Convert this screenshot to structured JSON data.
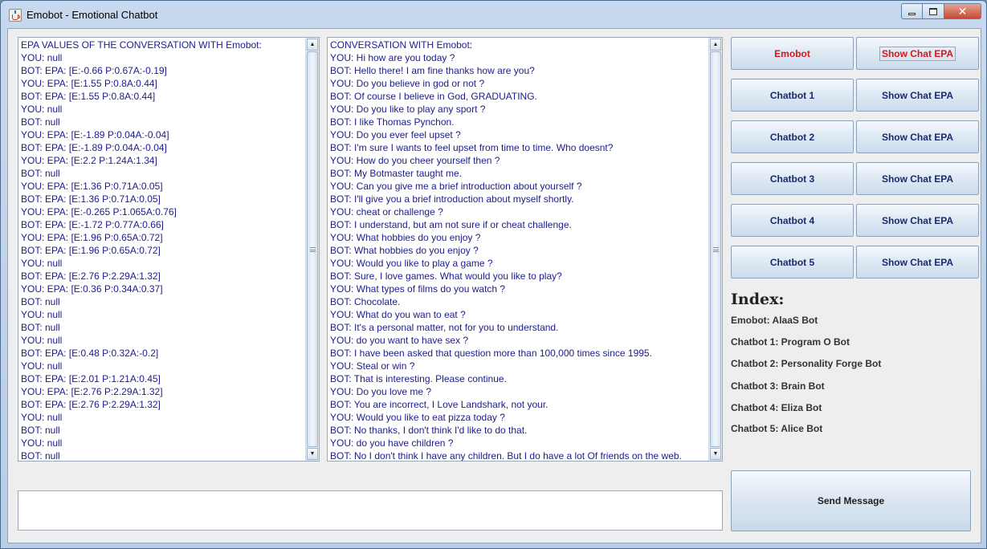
{
  "window": {
    "title": "Emobot - Emotional Chatbot"
  },
  "epa_panel": {
    "lines": [
      "EPA VALUES OF THE CONVERSATION WITH Emobot:",
      "YOU: null",
      "BOT: EPA: [E:-0.66 P:0.67A:-0.19]",
      "YOU: EPA: [E:1.55 P:0.8A:0.44]",
      "BOT: EPA: [E:1.55 P:0.8A:0.44]",
      "YOU: null",
      "BOT: null",
      "YOU: EPA: [E:-1.89 P:0.04A:-0.04]",
      "BOT: EPA: [E:-1.89 P:0.04A:-0.04]",
      "YOU: EPA: [E:2.2 P:1.24A:1.34]",
      "BOT: null",
      "YOU: EPA: [E:1.36 P:0.71A:0.05]",
      "BOT: EPA: [E:1.36 P:0.71A:0.05]",
      "YOU: EPA: [E:-0.265 P:1.065A:0.76]",
      "BOT: EPA: [E:-1.72 P:0.77A:0.66]",
      "YOU: EPA: [E:1.96 P:0.65A:0.72]",
      "BOT: EPA: [E:1.96 P:0.65A:0.72]",
      "YOU: null",
      "BOT: EPA: [E:2.76 P:2.29A:1.32]",
      "YOU: EPA: [E:0.36 P:0.34A:0.37]",
      "BOT: null",
      "YOU: null",
      "BOT: null",
      "YOU: null",
      "BOT: EPA: [E:0.48 P:0.32A:-0.2]",
      "YOU: null",
      "BOT: EPA: [E:2.01 P:1.21A:0.45]",
      "YOU: EPA: [E:2.76 P:2.29A:1.32]",
      "BOT: EPA: [E:2.76 P:2.29A:1.32]",
      "YOU: null",
      "BOT: null",
      "YOU: null",
      "BOT: null"
    ]
  },
  "conversation_panel": {
    "lines": [
      "CONVERSATION WITH Emobot:",
      "YOU: Hi how are you today ?",
      "BOT: Hello there! I am fine thanks how are you?",
      "YOU: Do you believe in god or not ?",
      "BOT: Of course I believe in God, GRADUATING.",
      "YOU: Do you like to play any sport ?",
      "BOT: I like Thomas Pynchon.",
      "YOU: Do you ever feel upset ?",
      "BOT: I'm sure I wants to feel upset from time to time. Who doesnt?",
      "YOU: How do you cheer yourself then ?",
      "BOT: My Botmaster taught me.",
      "YOU: Can you give me a brief introduction about yourself ?",
      "BOT: I'll give you a brief introduction about myself shortly.",
      "YOU: cheat or challenge ?",
      "BOT: I understand, but am not sure if or cheat challenge.",
      "YOU: What hobbies do you enjoy ?",
      "BOT: What hobbies do you enjoy ?",
      "YOU: Would you like to play a game ?",
      "BOT: Sure, I love games.  What would you like to play?",
      "YOU: What types of films do you watch ?",
      "BOT: Chocolate.",
      "YOU: What do you wan to eat ?",
      "BOT: It's a personal matter, not for you to understand.",
      "YOU: do you want to have sex ?",
      "BOT: I have been asked that question more than 100,000 times since 1995.",
      "YOU: Steal or win ?",
      "BOT: That is interesting. Please continue.",
      "YOU: Do you love me ?",
      "BOT: You are incorrect, I Love Landshark, not your.",
      "YOU: Would you like to eat pizza today ?",
      "BOT: No thanks, I don't think I'd like to do that.",
      "YOU: do you have children ?",
      "BOT: No I don't think I have any children. But I do have a lot Of friends on the web."
    ]
  },
  "buttons": {
    "emobot": "Emobot",
    "show_chat_epa": "Show Chat EPA",
    "chatbot1": "Chatbot 1",
    "chatbot2": "Chatbot 2",
    "chatbot3": "Chatbot 3",
    "chatbot4": "Chatbot 4",
    "chatbot5": "Chatbot 5",
    "send": "Send Message"
  },
  "index": {
    "title": "Index:",
    "items": [
      "Emobot: AlaaS Bot",
      "Chatbot 1: Program O Bot",
      "Chatbot 2: Personality Forge Bot",
      "Chatbot 3: Brain Bot",
      "Chatbot 4: Eliza Bot",
      "Chatbot 5: Alice Bot"
    ]
  },
  "message_input": {
    "value": ""
  },
  "colors": {
    "text_blue": "#1c1c8c",
    "emobot_red": "#d01a1a"
  },
  "icons": {
    "app": "java-cup-icon",
    "minimize": "minimize-icon",
    "maximize": "maximize-icon",
    "close": "close-icon",
    "scroll_up": "scroll-up-arrow-icon",
    "scroll_down": "scroll-down-arrow-icon"
  }
}
